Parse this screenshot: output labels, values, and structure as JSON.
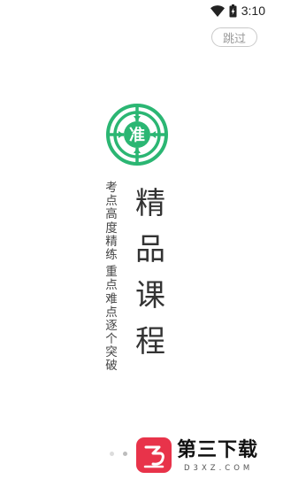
{
  "status_bar": {
    "time": "3:10",
    "icons": [
      "wifi-icon",
      "battery-icon"
    ]
  },
  "skip_button": {
    "label": "跳过"
  },
  "logo": {
    "text": "准",
    "color": "#2bb673"
  },
  "title": {
    "chars": [
      "精",
      "品",
      "课",
      "程"
    ]
  },
  "subtitle": {
    "line1": [
      "考",
      "点",
      "高",
      "度",
      "精",
      "练"
    ],
    "line2": [
      "重",
      "点",
      "难",
      "点",
      "逐",
      "个",
      "突",
      "破"
    ]
  },
  "pager": {
    "count": 3,
    "active_index": 1
  },
  "watermark": {
    "brand": "第三下载",
    "domain": "D3XZ.COM",
    "color": "#e8334a"
  }
}
